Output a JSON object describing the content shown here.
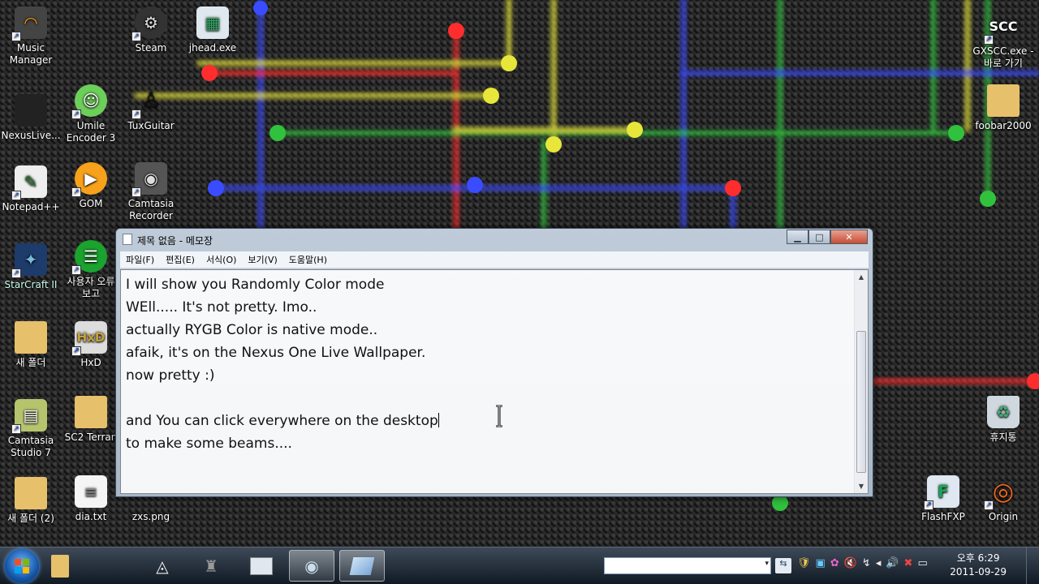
{
  "desktop": {
    "icons": [
      {
        "label": "Music\nManager",
        "icon": "headphones-icon"
      },
      {
        "label": "NexusLive...",
        "icon": "app-icon"
      },
      {
        "label": "Notepad++",
        "icon": "notepadpp-icon"
      },
      {
        "label": "StarCraft II",
        "icon": "starcraft-icon"
      },
      {
        "label": "새 폴더",
        "icon": "folder-icon"
      },
      {
        "label": "Camtasia\nStudio 7",
        "icon": "camtasia-icon"
      },
      {
        "label": "새 폴더 (2)",
        "icon": "folder-icon"
      },
      {
        "label": "Steam",
        "icon": "steam-icon"
      },
      {
        "label": "Umile\nEncoder 3",
        "icon": "umile-icon"
      },
      {
        "label": "GOM",
        "icon": "gom-icon"
      },
      {
        "label": "사용자 오류\n보고",
        "icon": "report-icon"
      },
      {
        "label": "HxD",
        "icon": "hxd-icon"
      },
      {
        "label": "SC2 Terran",
        "icon": "folder-icon"
      },
      {
        "label": "dia.txt",
        "icon": "text-file-icon"
      },
      {
        "label": "jhead.exe",
        "icon": "exe-icon"
      },
      {
        "label": "TuxGuitar",
        "icon": "tux-icon"
      },
      {
        "label": "Camtasia\nRecorder",
        "icon": "recorder-icon"
      },
      {
        "label": "zxs.png",
        "icon": "image-icon"
      },
      {
        "label": "GXSCC.exe -\n바로 가기",
        "icon": "scc-icon"
      },
      {
        "label": "foobar2000",
        "icon": "folder-icon"
      },
      {
        "label": "휴지통",
        "icon": "recycle-bin-icon"
      },
      {
        "label": "FlashFXP",
        "icon": "flashfxp-icon"
      },
      {
        "label": "Origin",
        "icon": "origin-icon"
      }
    ]
  },
  "notepad": {
    "title": "제목 없음 - 메모장",
    "menu": [
      "파일(F)",
      "편집(E)",
      "서식(O)",
      "보기(V)",
      "도움말(H)"
    ],
    "lines": [
      "I will show you Randomly Color mode",
      "WEll..... It's not pretty. Imo..",
      "actually RYGB Color is native mode..",
      "afaik, it's on the Nexus One Live Wallpaper.",
      "now pretty :)",
      "",
      "and You can click everywhere on the desktop",
      "to make some beams...."
    ],
    "minimize_glyph": "▁",
    "maximize_glyph": "□",
    "close_glyph": "✕",
    "scroll_up": "▲",
    "scroll_down": "▼"
  },
  "taskbar": {
    "clock_time": "오후 6:29",
    "clock_date": "2011-09-29",
    "address_dropdown": "▾",
    "go_glyph": "⇆",
    "tray": [
      "🛡",
      "▣",
      "✿",
      "🔇",
      "↯",
      "◂",
      "🔊",
      "✖",
      "▭"
    ]
  }
}
